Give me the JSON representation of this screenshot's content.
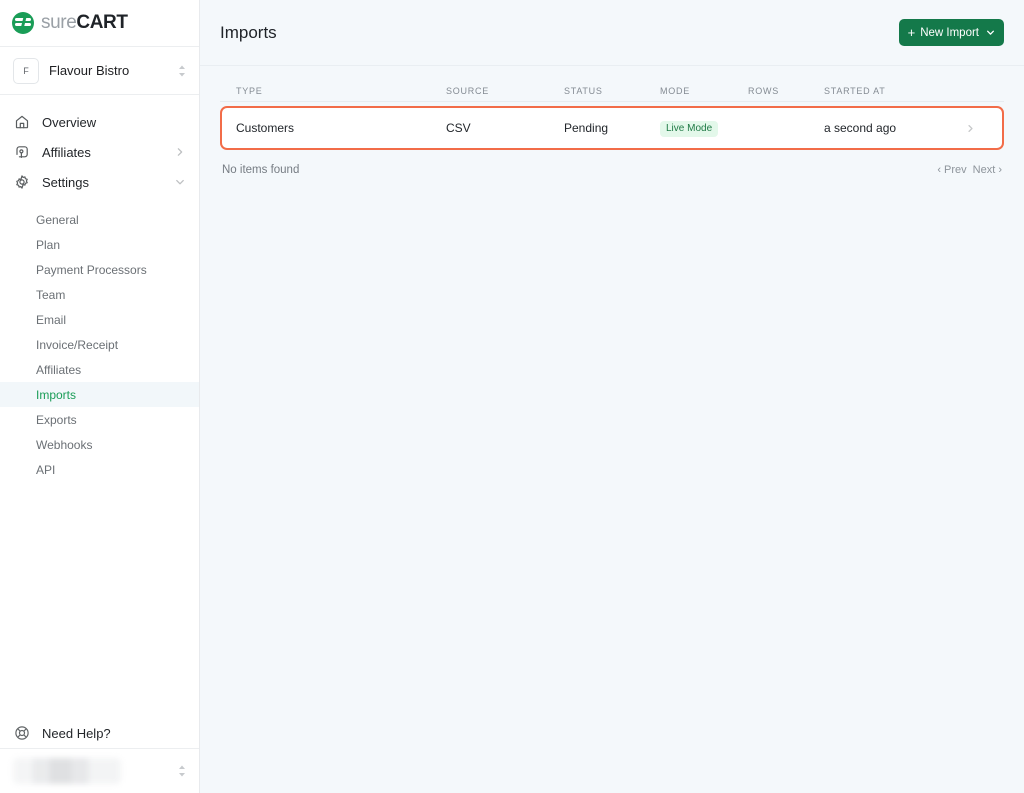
{
  "sidebar": {
    "brand": {
      "name_light": "sure",
      "name_bold": "CART",
      "logo_icon": "surecart-logo-icon"
    },
    "store": {
      "avatar_initial": "F",
      "name": "Flavour Bistro",
      "selector_icon": "up-down-chevron-icon"
    },
    "nav": [
      {
        "label": "Overview",
        "icon": "home-icon",
        "chevron": ""
      },
      {
        "label": "Affiliates",
        "icon": "megaphone-icon",
        "chevron": "chevron-right-icon"
      },
      {
        "label": "Settings",
        "icon": "gear-icon",
        "chevron": "chevron-down-icon"
      }
    ],
    "subnav": [
      {
        "label": "General",
        "active": false
      },
      {
        "label": "Plan",
        "active": false
      },
      {
        "label": "Payment Processors",
        "active": false
      },
      {
        "label": "Team",
        "active": false
      },
      {
        "label": "Email",
        "active": false
      },
      {
        "label": "Invoice/Receipt",
        "active": false
      },
      {
        "label": "Affiliates",
        "active": false
      },
      {
        "label": "Imports",
        "active": true
      },
      {
        "label": "Exports",
        "active": false
      },
      {
        "label": "Webhooks",
        "active": false
      },
      {
        "label": "API",
        "active": false
      }
    ],
    "help": {
      "label": "Need Help?",
      "icon": "lifebuoy-icon"
    },
    "user": {
      "name": "",
      "selector_icon": "up-down-chevron-icon"
    },
    "active_accent": "#1a9d57",
    "active_background": "#f2f7fa"
  },
  "header": {
    "title": "Imports",
    "new_import_label": "New Import",
    "new_import_plus": "+",
    "new_import_chevron_icon": "chevron-down-icon",
    "button_color": "#14794a"
  },
  "table": {
    "columns": [
      {
        "key": "type",
        "label": "TYPE"
      },
      {
        "key": "source",
        "label": "SOURCE"
      },
      {
        "key": "status",
        "label": "STATUS"
      },
      {
        "key": "mode",
        "label": "MODE"
      },
      {
        "key": "rows",
        "label": "ROWS"
      },
      {
        "key": "started_at",
        "label": "STARTED AT"
      }
    ],
    "rows": [
      {
        "type": "Customers",
        "source": "CSV",
        "status": "Pending",
        "mode": "Live Mode",
        "rows": "",
        "started_at": "a second ago",
        "chevron_icon": "chevron-right-icon",
        "highlighted": true
      }
    ],
    "highlight_color": "#f26c48",
    "badge_bg": "#e3f8ea",
    "badge_fg": "#1f7a45"
  },
  "footer": {
    "empty_text": "No items found",
    "prev_label": "‹ Prev",
    "next_label": "Next ›"
  }
}
